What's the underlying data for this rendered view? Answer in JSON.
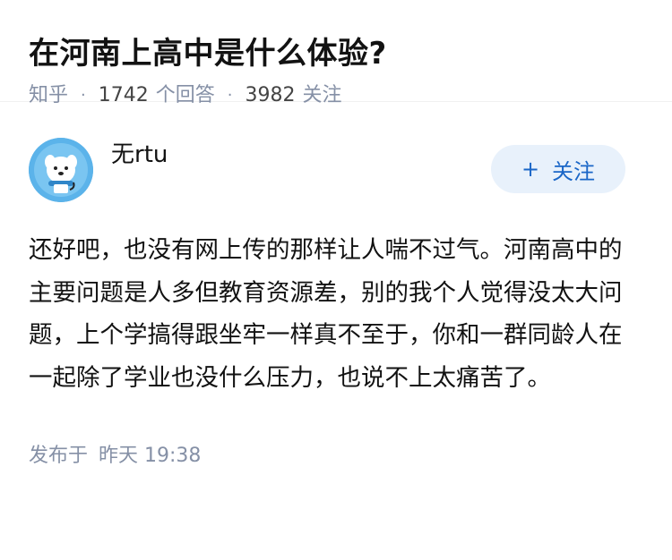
{
  "question": {
    "title": "在河南上高中是什么体验?",
    "source": "知乎",
    "answer_count": "1742",
    "answer_label": "个回答",
    "follower_count": "3982",
    "follower_label": "关注"
  },
  "answer": {
    "author_name": "无rtu",
    "avatar_icon": "cartoon-dog-avatar",
    "follow_label": "关注",
    "follow_icon": "plus-icon",
    "content": "还好吧，也没有网上传的那样让人喘不过气。河南高中的主要问题是人多但教育资源差，别的我个人觉得没太大问题，上个学搞得跟坐牢一样真不至于，你和一群同龄人在一起除了学业也没什么压力，也说不上太痛苦了。",
    "publish_label": "发布于",
    "publish_time": "昨天 19:38"
  },
  "colors": {
    "accent": "#1a66c7",
    "follow_bg": "#e8f1fb",
    "meta_text": "#8590a6"
  }
}
